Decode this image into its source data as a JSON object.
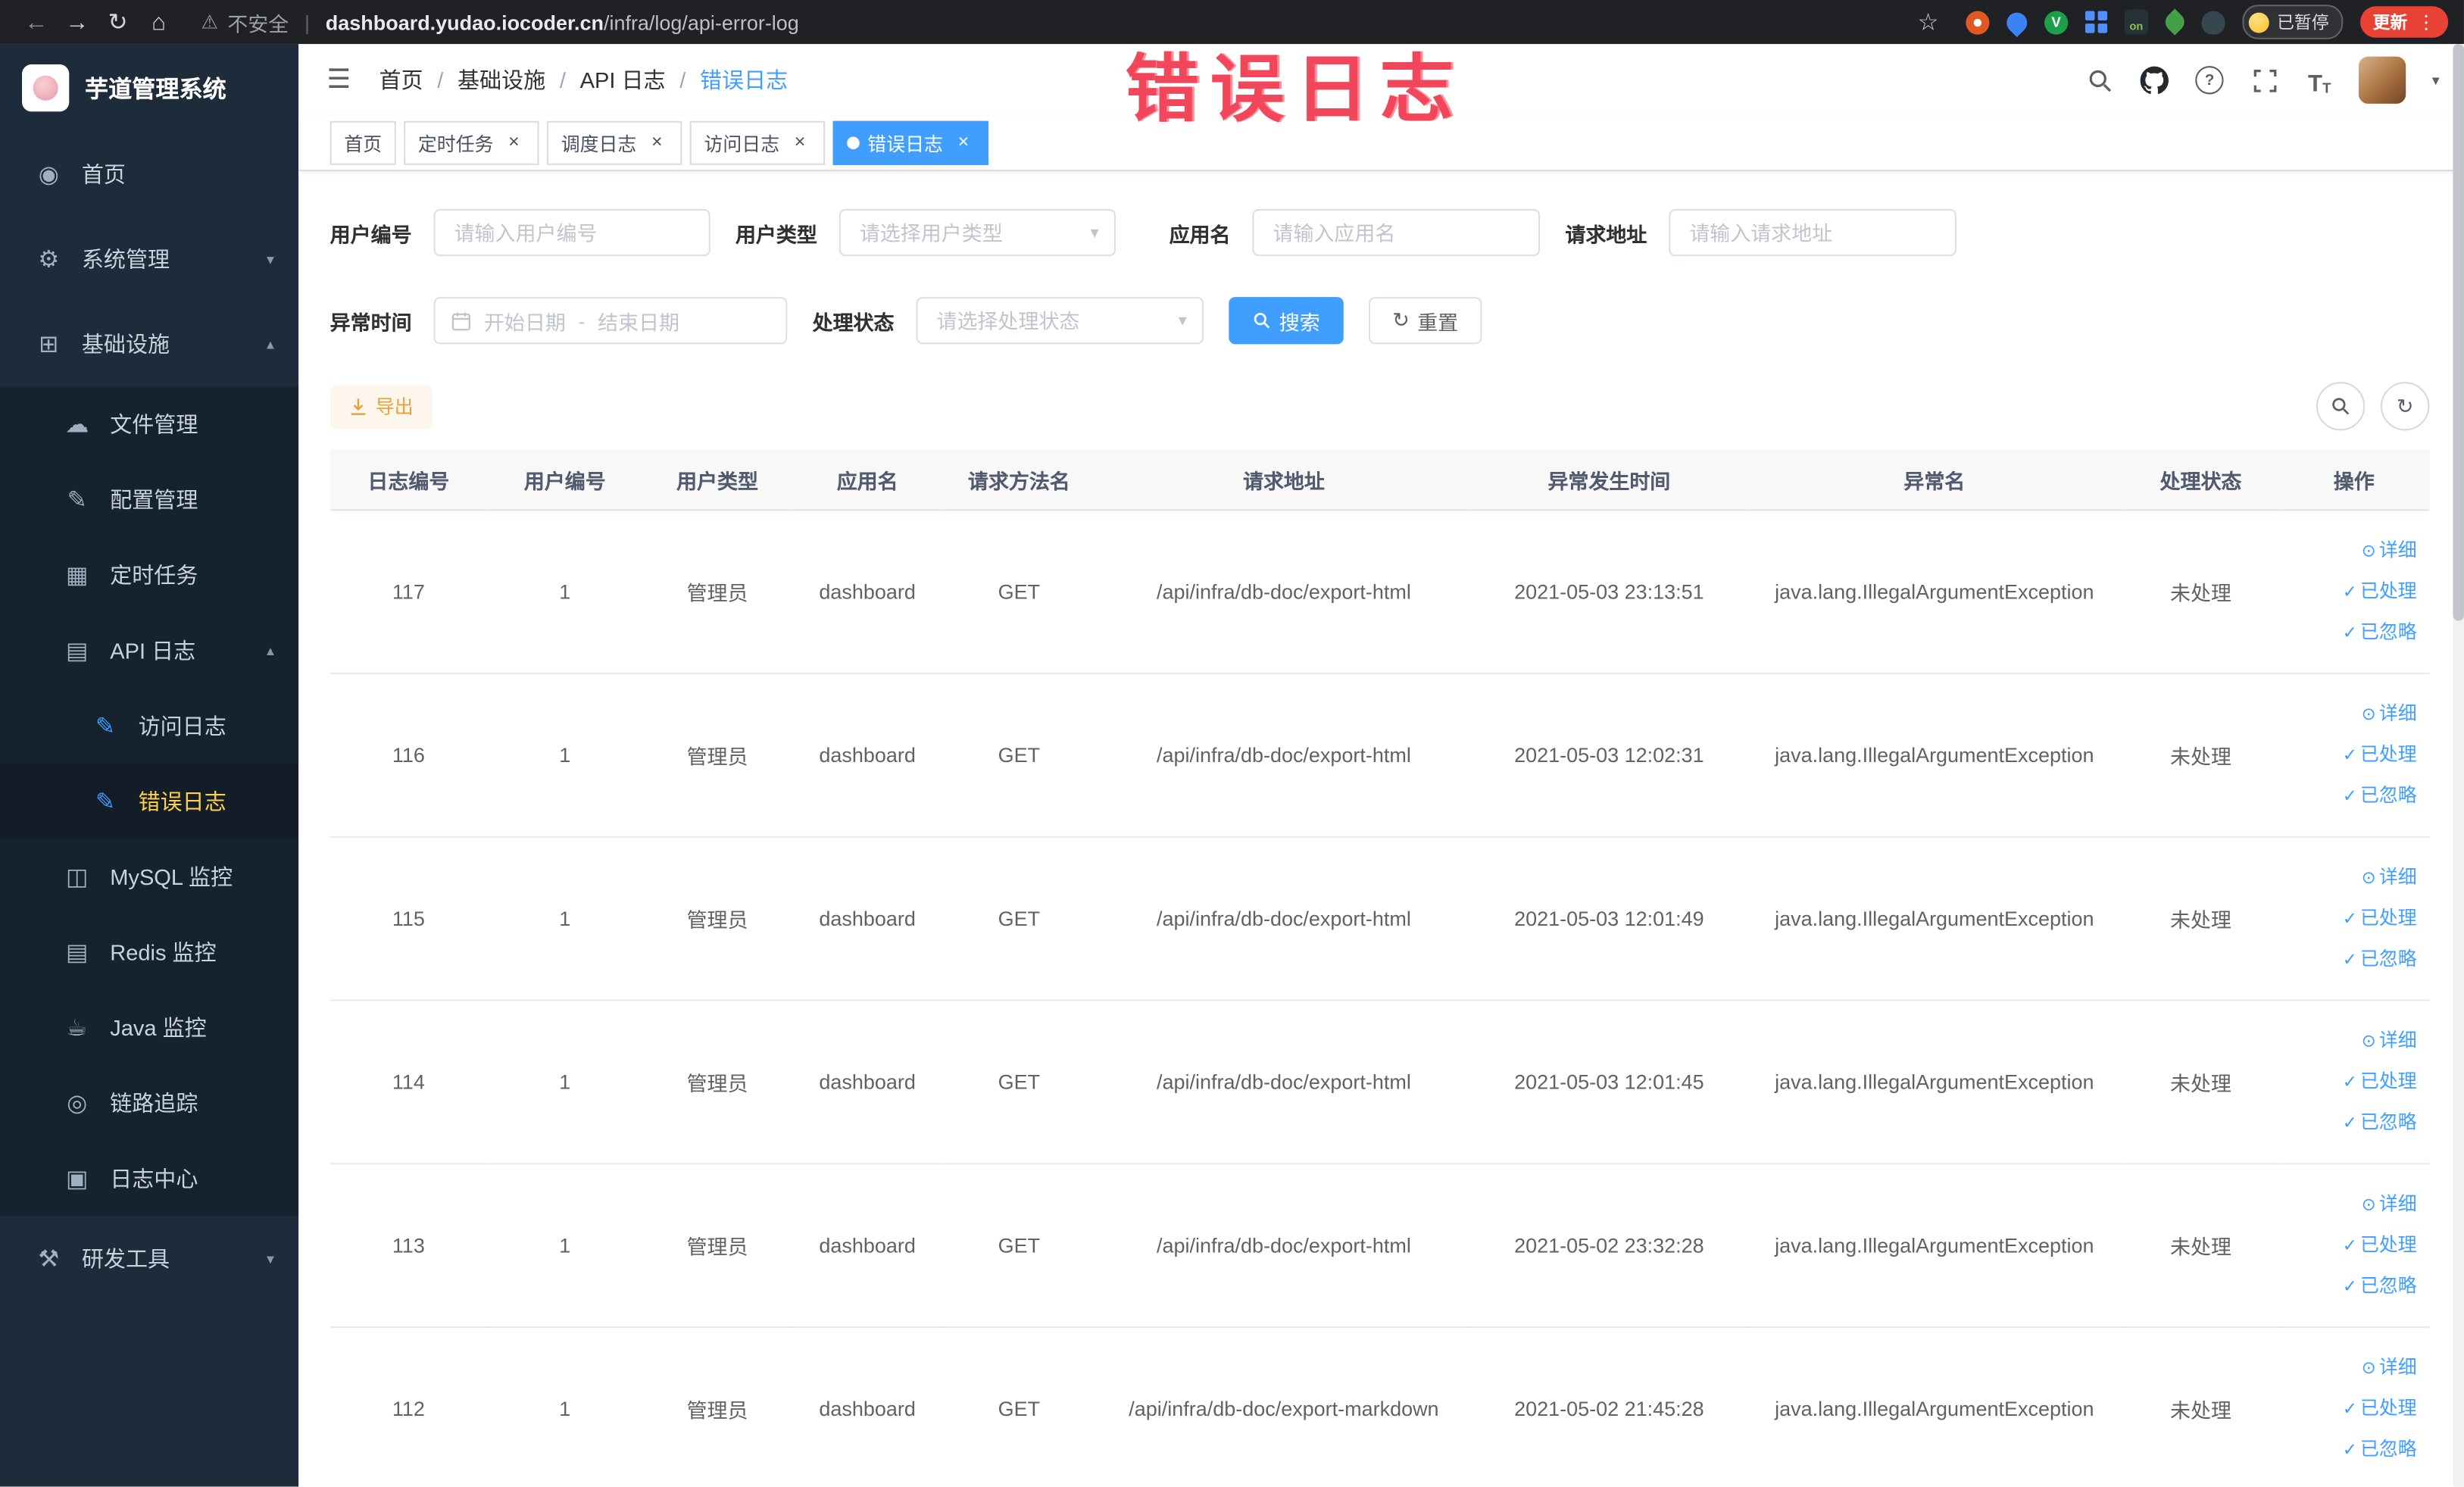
{
  "colors": {
    "accent_blue": "#409eff",
    "active_menu_text": "#ffd04b",
    "warning_orange": "#e6a23c",
    "annotation_red": "#f2465a",
    "update_button_red": "#e94235",
    "sidebar_bg": "#1d2b3a"
  },
  "browser": {
    "security_text": "不安全",
    "url_domain": "dashboard.yudao.iocoder.cn",
    "url_path": "/infra/log/api-error-log",
    "ext_on_text": "on",
    "ext_v_text": "V",
    "paused_badge": "已暂停",
    "update_button": "更新"
  },
  "annotation": {
    "text": "错误日志"
  },
  "sidebar": {
    "title": "芋道管理系统",
    "items": [
      {
        "label": "首页",
        "icon": "dashboard"
      },
      {
        "label": "系统管理",
        "icon": "gear"
      },
      {
        "label": "基础设施",
        "icon": "infrastructure"
      },
      {
        "label": "文件管理",
        "icon": "cloud"
      },
      {
        "label": "配置管理",
        "icon": "edit"
      },
      {
        "label": "定时任务",
        "icon": "task"
      },
      {
        "label": "API 日志",
        "icon": "api-log"
      },
      {
        "label": "访问日志",
        "icon": "access-log"
      },
      {
        "label": "错误日志",
        "icon": "error-log"
      },
      {
        "label": "MySQL 监控",
        "icon": "mysql"
      },
      {
        "label": "Redis 监控",
        "icon": "redis"
      },
      {
        "label": "Java 监控",
        "icon": "java"
      },
      {
        "label": "链路追踪",
        "icon": "trace"
      },
      {
        "label": "日志中心",
        "icon": "log-center"
      },
      {
        "label": "研发工具",
        "icon": "tools"
      }
    ]
  },
  "header": {
    "breadcrumb": [
      "首页",
      "基础设施",
      "API 日志",
      "错误日志"
    ],
    "breadcrumb_separator": "/"
  },
  "tabs": [
    {
      "label": "首页"
    },
    {
      "label": "定时任务"
    },
    {
      "label": "调度日志"
    },
    {
      "label": "访问日志"
    },
    {
      "label": "错误日志"
    }
  ],
  "filters": {
    "user_id_label": "用户编号",
    "user_id_placeholder": "请输入用户编号",
    "user_type_label": "用户类型",
    "user_type_placeholder": "请选择用户类型",
    "app_name_label": "应用名",
    "app_name_placeholder": "请输入应用名",
    "request_url_label": "请求地址",
    "request_url_placeholder": "请输入请求地址",
    "exception_time_label": "异常时间",
    "start_date_placeholder": "开始日期",
    "range_separator": "-",
    "end_date_placeholder": "结束日期",
    "status_label": "处理状态",
    "status_placeholder": "请选择处理状态",
    "search_button": "搜索",
    "reset_button": "重置"
  },
  "toolbar": {
    "export_button": "导出"
  },
  "table": {
    "headers": [
      "日志编号",
      "用户编号",
      "用户类型",
      "应用名",
      "请求方法名",
      "请求地址",
      "异常发生时间",
      "异常名",
      "处理状态",
      "操作"
    ],
    "actions": [
      "详细",
      "已处理",
      "已忽略"
    ],
    "rows": [
      {
        "id": "117",
        "user_id": "1",
        "user_type": "管理员",
        "app": "dashboard",
        "method": "GET",
        "url": "/api/infra/db-doc/export-html",
        "time": "2021-05-03 23:13:51",
        "exception": "java.lang.IllegalArgumentException",
        "status": "未处理"
      },
      {
        "id": "116",
        "user_id": "1",
        "user_type": "管理员",
        "app": "dashboard",
        "method": "GET",
        "url": "/api/infra/db-doc/export-html",
        "time": "2021-05-03 12:02:31",
        "exception": "java.lang.IllegalArgumentException",
        "status": "未处理"
      },
      {
        "id": "115",
        "user_id": "1",
        "user_type": "管理员",
        "app": "dashboard",
        "method": "GET",
        "url": "/api/infra/db-doc/export-html",
        "time": "2021-05-03 12:01:49",
        "exception": "java.lang.IllegalArgumentException",
        "status": "未处理"
      },
      {
        "id": "114",
        "user_id": "1",
        "user_type": "管理员",
        "app": "dashboard",
        "method": "GET",
        "url": "/api/infra/db-doc/export-html",
        "time": "2021-05-03 12:01:45",
        "exception": "java.lang.IllegalArgumentException",
        "status": "未处理"
      },
      {
        "id": "113",
        "user_id": "1",
        "user_type": "管理员",
        "app": "dashboard",
        "method": "GET",
        "url": "/api/infra/db-doc/export-html",
        "time": "2021-05-02 23:32:28",
        "exception": "java.lang.IllegalArgumentException",
        "status": "未处理"
      },
      {
        "id": "112",
        "user_id": "1",
        "user_type": "管理员",
        "app": "dashboard",
        "method": "GET",
        "url": "/api/infra/db-doc/export-markdown",
        "time": "2021-05-02 21:45:28",
        "exception": "java.lang.IllegalArgumentException",
        "status": "未处理"
      }
    ]
  }
}
